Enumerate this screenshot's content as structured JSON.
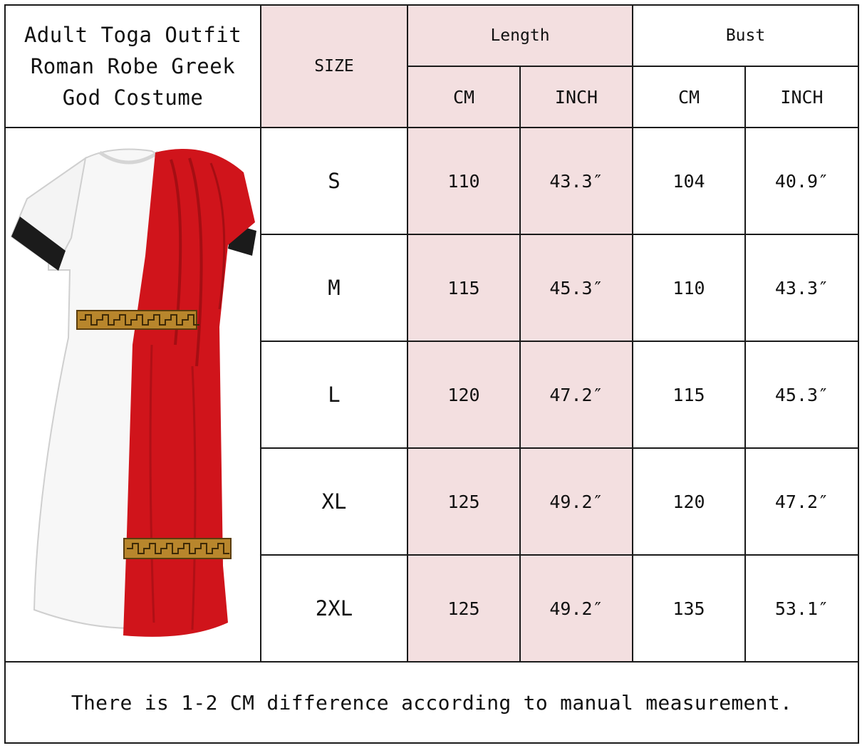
{
  "title": "Adult Toga Outfit Roman Robe Greek God Costume",
  "headers": {
    "size": "SIZE",
    "length": "Length",
    "bust": "Bust",
    "length_cm": "CM",
    "length_inch": "INCH",
    "bust_cm": "CM",
    "bust_inch": "INCH"
  },
  "rows": [
    {
      "size": "S",
      "length_cm": "110",
      "length_inch": "43.3″",
      "bust_cm": "104",
      "bust_inch": "40.9″"
    },
    {
      "size": "M",
      "length_cm": "115",
      "length_inch": "45.3″",
      "bust_cm": "110",
      "bust_inch": "43.3″"
    },
    {
      "size": "L",
      "length_cm": "120",
      "length_inch": "47.2″",
      "bust_cm": "115",
      "bust_inch": "45.3″"
    },
    {
      "size": "XL",
      "length_cm": "125",
      "length_inch": "49.2″",
      "bust_cm": "120",
      "bust_inch": "47.2″"
    },
    {
      "size": "2XL",
      "length_cm": "125",
      "length_inch": "49.2″",
      "bust_cm": "135",
      "bust_inch": "53.1″"
    }
  ],
  "note": "There is 1-2 CM difference according to manual measurement.",
  "colors": {
    "header_pink": "#f3dfe0",
    "grid_line": "#1a1a1a",
    "toga_red": "#d0141b",
    "toga_white": "#f7f7f7",
    "trim_gold": "#b8862c"
  },
  "image": {
    "icon": "toga-costume-illustration"
  }
}
